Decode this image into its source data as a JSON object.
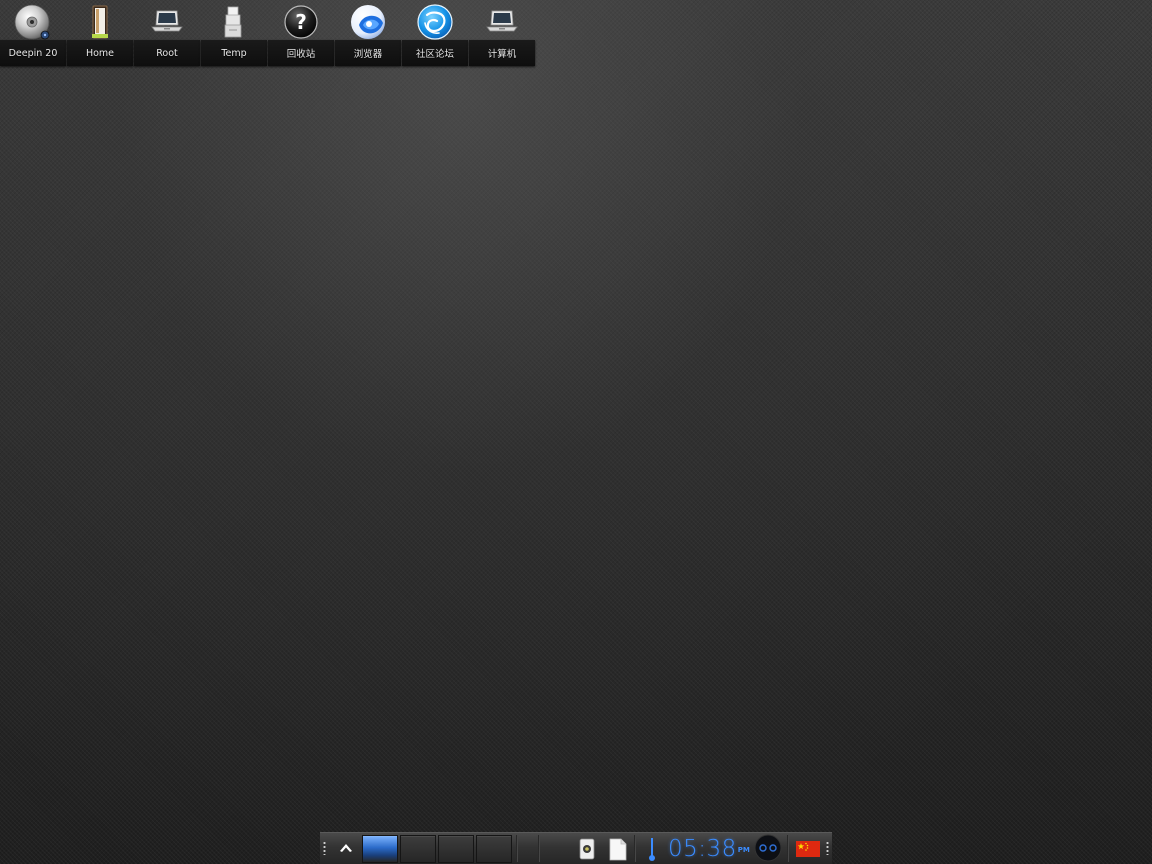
{
  "desktop": {
    "icons": [
      {
        "label": "Deepin 20",
        "icon": "cd-disc-icon"
      },
      {
        "label": "Home",
        "icon": "home-door-icon"
      },
      {
        "label": "Root",
        "icon": "laptop-icon"
      },
      {
        "label": "Temp",
        "icon": "folder-stack-icon"
      },
      {
        "label": "回收站",
        "icon": "help-question-icon"
      },
      {
        "label": "浏览器",
        "icon": "browser-icon"
      },
      {
        "label": "社区论坛",
        "icon": "deepin-logo-icon"
      },
      {
        "label": "计算机",
        "icon": "computer-icon"
      }
    ]
  },
  "panel": {
    "virtual_desktops": 4,
    "active_desktop": 1,
    "clock": {
      "time": "05:38",
      "ampm": "PM"
    },
    "locale_flag": "china-flag-icon"
  },
  "colors": {
    "clock": "#3b8cff",
    "desktop_bg": "#2e2e2e",
    "label_bg": "#111111"
  }
}
